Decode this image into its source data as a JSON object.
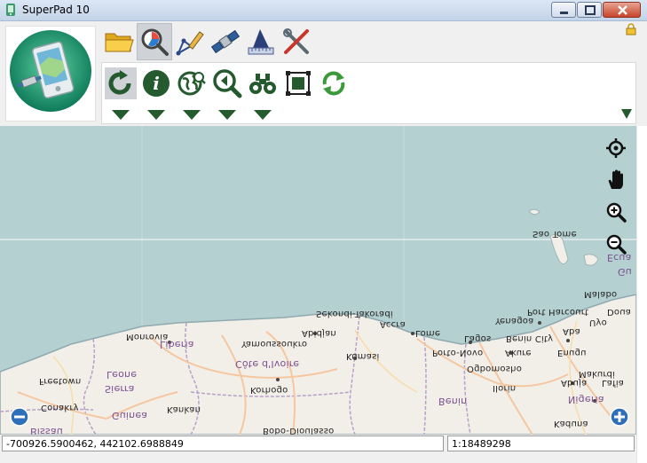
{
  "window": {
    "title": "SuperPad 10"
  },
  "tabs": [
    {
      "name": "file",
      "icon": "folder-icon"
    },
    {
      "name": "browse",
      "icon": "magnifier-icon",
      "active": true
    },
    {
      "name": "edit",
      "icon": "pen-icon"
    },
    {
      "name": "gps",
      "icon": "satellite-icon"
    },
    {
      "name": "measure",
      "icon": "ruler-icon"
    },
    {
      "name": "tools",
      "icon": "tools-icon"
    }
  ],
  "ribbon": {
    "buttons": [
      {
        "icon": "refresh-icon",
        "active": true
      },
      {
        "icon": "info-icon"
      },
      {
        "icon": "globe-search-icon"
      },
      {
        "icon": "zoom-previous-icon"
      },
      {
        "icon": "binoculars-icon"
      },
      {
        "icon": "select-frame-icon"
      },
      {
        "icon": "sync-icon"
      }
    ]
  },
  "map": {
    "labels": [
      {
        "text": "Sao Tome",
        "type": "city"
      },
      {
        "text": "Malabo",
        "type": "city"
      },
      {
        "text": "Ecua",
        "type": "country"
      },
      {
        "text": "Gu",
        "type": "country"
      },
      {
        "text": "Sekondi-Takoradi",
        "type": "city"
      },
      {
        "text": "Port Harcourt",
        "type": "city"
      },
      {
        "text": "Doua",
        "type": "city"
      },
      {
        "text": "Yenagoa",
        "type": "city"
      },
      {
        "text": "Uyo",
        "type": "city"
      },
      {
        "text": "Monrovia",
        "type": "city"
      },
      {
        "text": "Abidjan",
        "type": "city"
      },
      {
        "text": "Accra",
        "type": "city"
      },
      {
        "text": "Lome",
        "type": "city"
      },
      {
        "text": "Lagos",
        "type": "city"
      },
      {
        "text": "Benin City",
        "type": "city"
      },
      {
        "text": "Aba",
        "type": "city"
      },
      {
        "text": "Liberia",
        "type": "country"
      },
      {
        "text": "Yamoussoukro",
        "type": "city"
      },
      {
        "text": "Porto-Novo",
        "type": "city"
      },
      {
        "text": "Akure",
        "type": "city"
      },
      {
        "text": "Enugu",
        "type": "city"
      },
      {
        "text": "Kumasi",
        "type": "city"
      },
      {
        "text": "Côte d'Ivoire",
        "type": "country"
      },
      {
        "text": "Ogbomosho",
        "type": "city"
      },
      {
        "text": "Makurdi",
        "type": "city"
      },
      {
        "text": "Freetown",
        "type": "city"
      },
      {
        "text": "Leone",
        "type": "country"
      },
      {
        "text": "Sierra",
        "type": "country"
      },
      {
        "text": "Korhogo",
        "type": "city"
      },
      {
        "text": "Ilorin",
        "type": "city"
      },
      {
        "text": "Abuja",
        "type": "city"
      },
      {
        "text": "Lafia",
        "type": "city"
      },
      {
        "text": "Benin",
        "type": "country"
      },
      {
        "text": "Nigeria",
        "type": "country"
      },
      {
        "text": "Conakry",
        "type": "city"
      },
      {
        "text": "Kankan",
        "type": "city"
      },
      {
        "text": "Guinea",
        "type": "country"
      },
      {
        "text": "Kaduna",
        "type": "city"
      },
      {
        "text": "Bissau",
        "type": "city"
      },
      {
        "text": "Bobo-Dioulasso",
        "type": "city"
      }
    ]
  },
  "status": {
    "coordinates": "-700926.5900462, 442102.6988849",
    "scale": "1:18489298"
  },
  "colors": {
    "water": "#b5d0d0",
    "land": "#f2efe9",
    "icon_green": "#245a2d",
    "border": "#b8a0c8"
  }
}
